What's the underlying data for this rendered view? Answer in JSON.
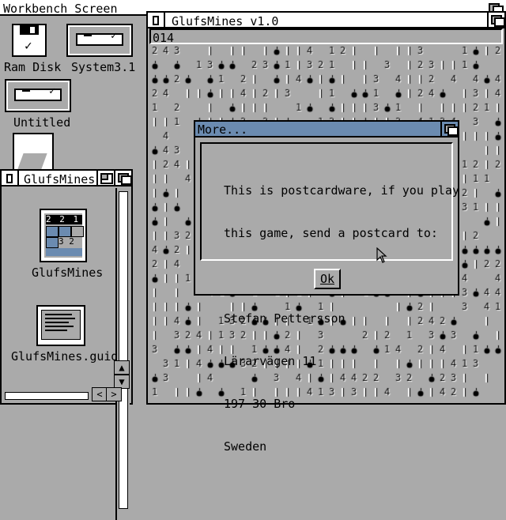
{
  "screen": {
    "title": "Workbench Screen"
  },
  "desktop_icons": [
    {
      "label": "Ram Disk"
    },
    {
      "label": "System3.1"
    },
    {
      "label": "Untitled"
    }
  ],
  "game_window": {
    "title": "GlufsMines v1.0",
    "mine_counter": "014"
  },
  "drawer_window": {
    "title": "GlufsMines",
    "icons": [
      {
        "label": "GlufsMines"
      },
      {
        "label": "GlufsMines.guide"
      }
    ]
  },
  "dialog": {
    "title": "More...",
    "message_lines": [
      "This is postcardware, if you play",
      "this game, send a postcard to:",
      "",
      "Stefan Pettersson",
      "Lärarvägen 11",
      "197 30 Bro",
      "Sweden"
    ],
    "ok_label": "Ok"
  },
  "colors": {
    "background": "#aaaaaa",
    "title_active": "#6b8bb0",
    "white": "#ffffff",
    "black": "#000000"
  }
}
